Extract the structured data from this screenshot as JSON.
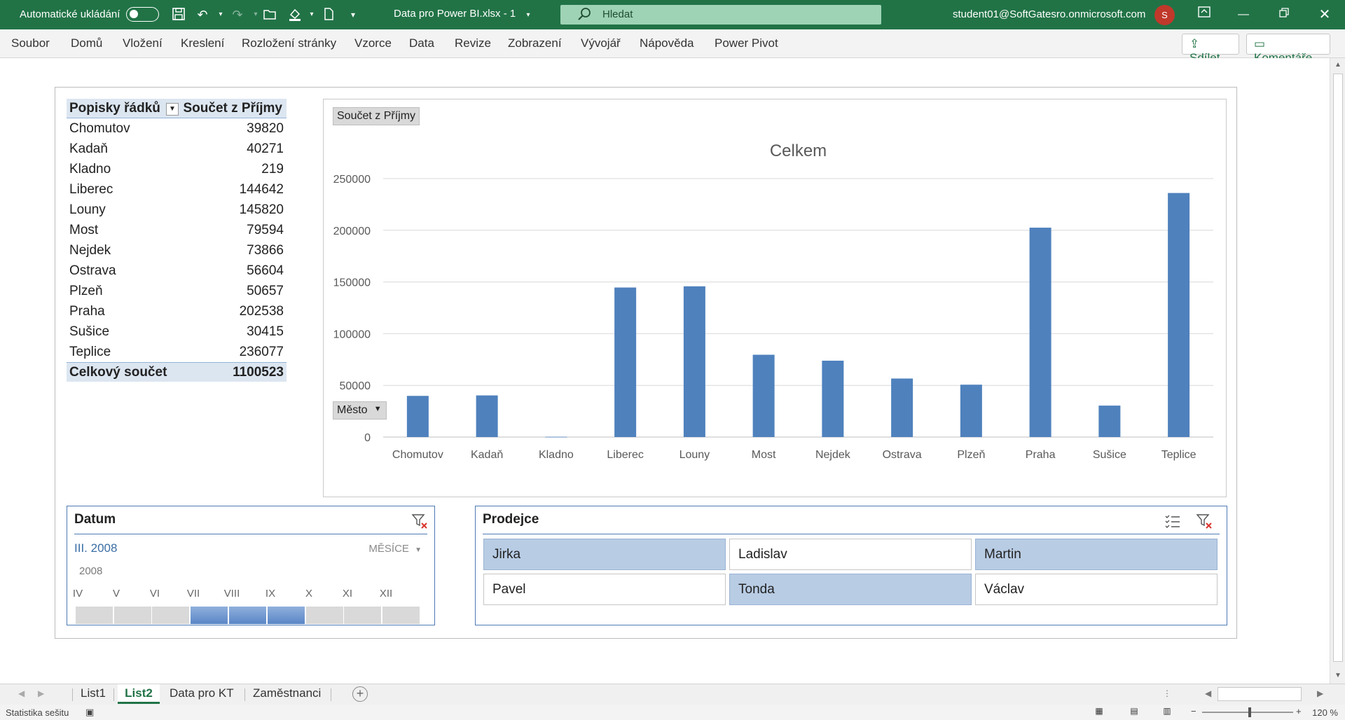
{
  "titlebar": {
    "autosave_label": "Automatické ukládání",
    "filename": "Data pro Power BI.xlsx  -  1",
    "search_placeholder": "Hledat",
    "user": "student01@SoftGatesro.onmicrosoft.com",
    "avatar_initial": "S"
  },
  "menu": {
    "items": [
      "Soubor",
      "Domů",
      "Vložení",
      "Kreslení",
      "Rozložení stránky",
      "Vzorce",
      "Data",
      "Revize",
      "Zobrazení",
      "Vývojář",
      "Nápověda",
      "Power Pivot"
    ],
    "share_label": "Sdílet",
    "comments_label": "Komentáře"
  },
  "pivot": {
    "header_rows": "Popisky řádků",
    "header_values": "Součet z Příjmy",
    "rows": [
      {
        "label": "Chomutov",
        "value": "39820"
      },
      {
        "label": "Kadaň",
        "value": "40271"
      },
      {
        "label": "Kladno",
        "value": "219"
      },
      {
        "label": "Liberec",
        "value": "144642"
      },
      {
        "label": "Louny",
        "value": "145820"
      },
      {
        "label": "Most",
        "value": "79594"
      },
      {
        "label": "Nejdek",
        "value": "73866"
      },
      {
        "label": "Ostrava",
        "value": "56604"
      },
      {
        "label": "Plzeň",
        "value": "50657"
      },
      {
        "label": "Praha",
        "value": "202538"
      },
      {
        "label": "Sušice",
        "value": "30415"
      },
      {
        "label": "Teplice",
        "value": "236077"
      }
    ],
    "total_label": "Celkový součet",
    "total_value": "1100523"
  },
  "chart_data": {
    "type": "bar",
    "title": "Celkem",
    "value_field_button": "Součet z Příjmy",
    "axis_field_button": "Město",
    "categories": [
      "Chomutov",
      "Kadaň",
      "Kladno",
      "Liberec",
      "Louny",
      "Most",
      "Nejdek",
      "Ostrava",
      "Plzeň",
      "Praha",
      "Sušice",
      "Teplice"
    ],
    "values": [
      39820,
      40271,
      219,
      144642,
      145820,
      79594,
      73866,
      56604,
      50657,
      202538,
      30415,
      236077
    ],
    "yticks": [
      "0",
      "50000",
      "100000",
      "150000",
      "200000",
      "250000"
    ],
    "ylim": [
      0,
      250000
    ],
    "bar_color": "#4f81bd",
    "grid": true
  },
  "slicer_datum": {
    "title": "Datum",
    "range": "III. 2008",
    "level": "MĚSÍCE",
    "year": "2008",
    "months": [
      "IV",
      "V",
      "VI",
      "VII",
      "VIII",
      "IX",
      "X",
      "XI",
      "XII"
    ],
    "selected": [
      false,
      false,
      false,
      true,
      true,
      true,
      false,
      false,
      false
    ]
  },
  "slicer_prodejce": {
    "title": "Prodejce",
    "items": [
      {
        "label": "Jirka",
        "selected": true
      },
      {
        "label": "Ladislav",
        "selected": false
      },
      {
        "label": "Martin",
        "selected": true
      },
      {
        "label": "Pavel",
        "selected": false
      },
      {
        "label": "Tonda",
        "selected": true
      },
      {
        "label": "Václav",
        "selected": false
      }
    ]
  },
  "tabs": {
    "sheets": [
      "List1",
      "List2",
      "Data pro KT",
      "Zaměstnanci"
    ],
    "active": "List2"
  },
  "status": {
    "left": "Statistika sešitu",
    "zoom": "120 %"
  },
  "colors": {
    "excel_green": "#217346",
    "accent_blue": "#4e7ab5",
    "selected_tile": "#b8cce4"
  }
}
